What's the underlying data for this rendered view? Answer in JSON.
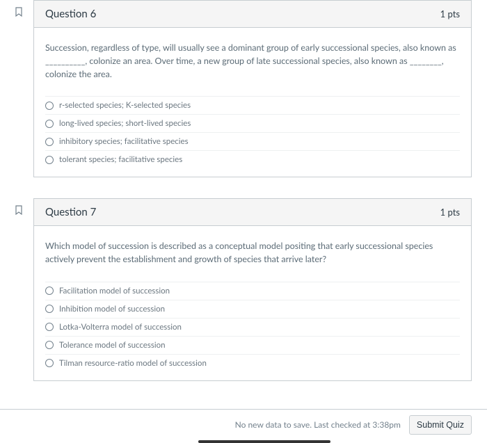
{
  "questions": [
    {
      "title": "Question 6",
      "pts": "1 pts",
      "text": "Succession, regardless of type, will usually see a dominant group of early successional species, also known as __________, colonize an area. Over time, a new group of late successional species, also known as ________, colonize the area.",
      "answers": [
        "r-selected species; K-selected species",
        "long-lived species; short-lived species",
        "inhibitory species; facilitative species",
        "tolerant species; facilitative species"
      ]
    },
    {
      "title": "Question 7",
      "pts": "1 pts",
      "text": "Which model of succession is described as a conceptual model positing that early successional species actively prevent the establishment and growth of species that arrive later?",
      "answers": [
        "Facilitation model of succession",
        "Inhibition model of succession",
        "Lotka-Volterra model of succession",
        "Tolerance model of succession",
        "Tilman resource-ratio model of succession"
      ]
    }
  ],
  "footer": {
    "status": "No new data to save. Last checked at 3:38pm",
    "submit": "Submit Quiz"
  }
}
